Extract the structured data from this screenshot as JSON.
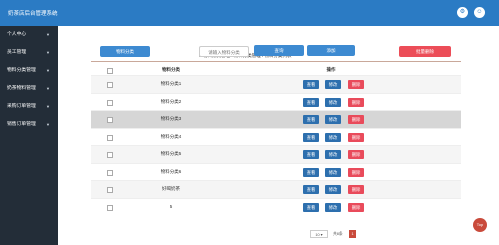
{
  "header": {
    "title": "奶茶店后台管理系统"
  },
  "sidebar": {
    "items": [
      {
        "label": "个人中心"
      },
      {
        "label": "员工管理"
      },
      {
        "label": "物料分类管理"
      },
      {
        "label": "奶茶物料管理"
      },
      {
        "label": "采购订单管理"
      },
      {
        "label": "销售订单管理"
      }
    ]
  },
  "toolbar": {
    "category_btn": "物料分类",
    "search_placeholder": "请输入物料分类",
    "query_btn": "查询",
    "add_btn": "添加",
    "batch_delete_btn": "批量删除"
  },
  "breadcrumb": {
    "text": "物料分类管理 / 物料分类管理 / 物料分类列表"
  },
  "table": {
    "headers": {
      "name": "物料分类",
      "op": "操作"
    },
    "rows": [
      {
        "name": "物料分类1"
      },
      {
        "name": "物料分类2"
      },
      {
        "name": "物料分类3"
      },
      {
        "name": "物料分类4"
      },
      {
        "name": "物料分类5"
      },
      {
        "name": "物料分类6"
      },
      {
        "name": "好喝奶茶"
      },
      {
        "name": "5"
      }
    ],
    "row_buttons": {
      "view": "查看",
      "edit": "修改",
      "delete": "删除"
    }
  },
  "pager": {
    "page_size": "10",
    "total_text": "共8条",
    "current_page": "1"
  },
  "back_to_top": "Top"
}
